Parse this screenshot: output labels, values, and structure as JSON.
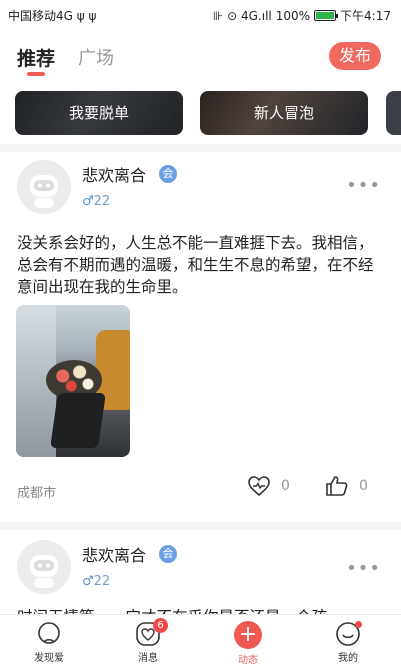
{
  "status_bar": {
    "carrier": "中国移动4G ψ ψ",
    "indicators": "⊪ ⊙ 4G.ıll",
    "battery_pct": "100%",
    "time": "下午4:17"
  },
  "header": {
    "tab_active": "推荐",
    "tab_inactive": "广场",
    "publish_label": "发布"
  },
  "banners": [
    {
      "label": "我要脱单"
    },
    {
      "label": "新人冒泡"
    }
  ],
  "posts": [
    {
      "username": "悲欢离合",
      "verify_badge": "会",
      "gender_symbol": "♂",
      "age": "22",
      "text": "没关系会好的，人生总不能一直难捱下去。我相信，总会有不期而遇的温暖，和生生不息的希望，在不经意间出现在我的生命里。",
      "location": "成都市",
      "likes": "0",
      "thumbs": "0",
      "image_icon": "bouquet-photo"
    },
    {
      "username": "悲欢离合",
      "verify_badge": "会",
      "gender_symbol": "♂",
      "age": "22",
      "text": "时间无情等……它才不在乎你是否还是一个孩"
    }
  ],
  "tabbar": {
    "items": [
      {
        "label": "发现爱",
        "icon": "discover-icon"
      },
      {
        "label": "消息",
        "icon": "heart-message-icon",
        "badge": "6"
      },
      {
        "label": "动态",
        "icon": "plus-icon"
      },
      {
        "label": "我的",
        "icon": "profile-icon"
      }
    ]
  },
  "colors": {
    "accent": "#f1685e",
    "verify_blue": "#6b9fe3",
    "male_blue": "#5a8fd6"
  }
}
